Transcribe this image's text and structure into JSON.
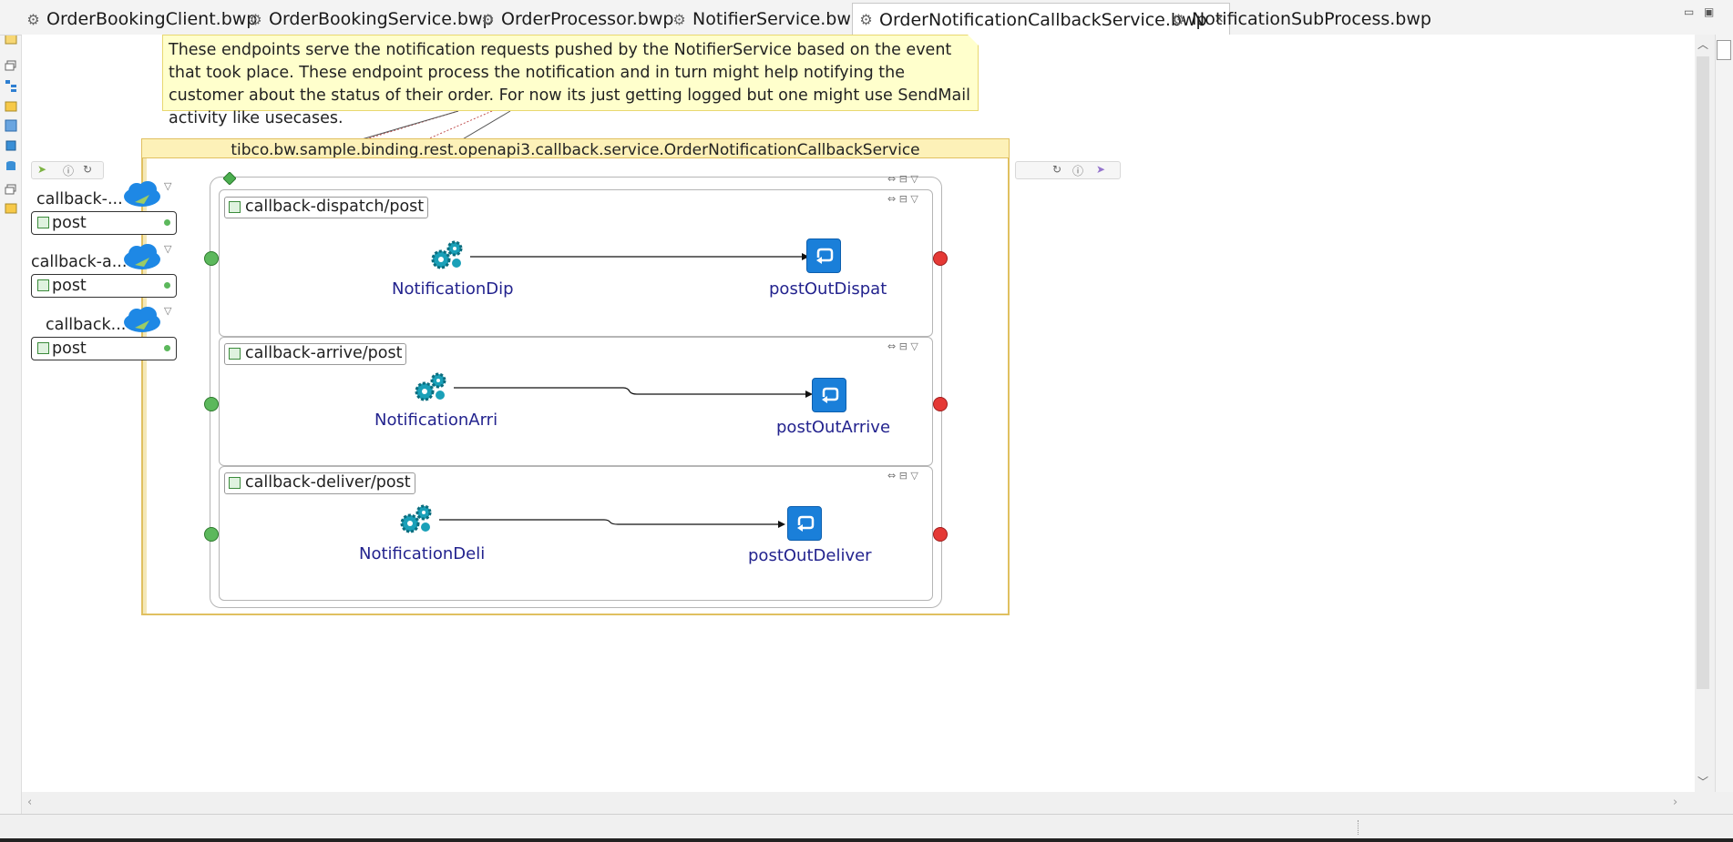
{
  "tabs": [
    {
      "label": "OrderBookingClient.bwp",
      "active": false
    },
    {
      "label": "OrderBookingService.bwp",
      "active": false
    },
    {
      "label": "OrderProcessor.bwp",
      "active": false
    },
    {
      "label": "NotifierService.bwp",
      "active": false
    },
    {
      "label": "OrderNotificationCallbackService.bwp",
      "active": true
    },
    {
      "label": "NotificationSubProcess.bwp",
      "active": false
    }
  ],
  "note": {
    "text": "These endpoints serve the notification requests pushed by the NotifierService based on the event that took place. These endpoint process the notification and in turn might help notifying the customer about the status of their order. For now its just getting logged but one might use SendMail activity like usecases."
  },
  "service": {
    "title": "tibco.bw.sample.binding.rest.openapi3.callback.service.OrderNotificationCallbackService"
  },
  "endpoints": [
    {
      "name": "callback-...",
      "operation": "post"
    },
    {
      "name": "callback-a...",
      "operation": "post"
    },
    {
      "name": "callback...",
      "operation": "post"
    }
  ],
  "lanes": [
    {
      "label": "callback-dispatch/post",
      "activity": "NotificationDip",
      "reply": "postOutDispat"
    },
    {
      "label": "callback-arrive/post",
      "activity": "NotificationArri",
      "reply": "postOutArrive"
    },
    {
      "label": "callback-deliver/post",
      "activity": "NotificationDeli",
      "reply": "postOutDeliver"
    }
  ],
  "colors": {
    "note_bg": "#ffffcc",
    "service_header": "#fdf1b8",
    "activity_text": "#23238e",
    "reply_icon": "#1a7fd9",
    "start": "#5cb85c",
    "end": "#e53935"
  }
}
